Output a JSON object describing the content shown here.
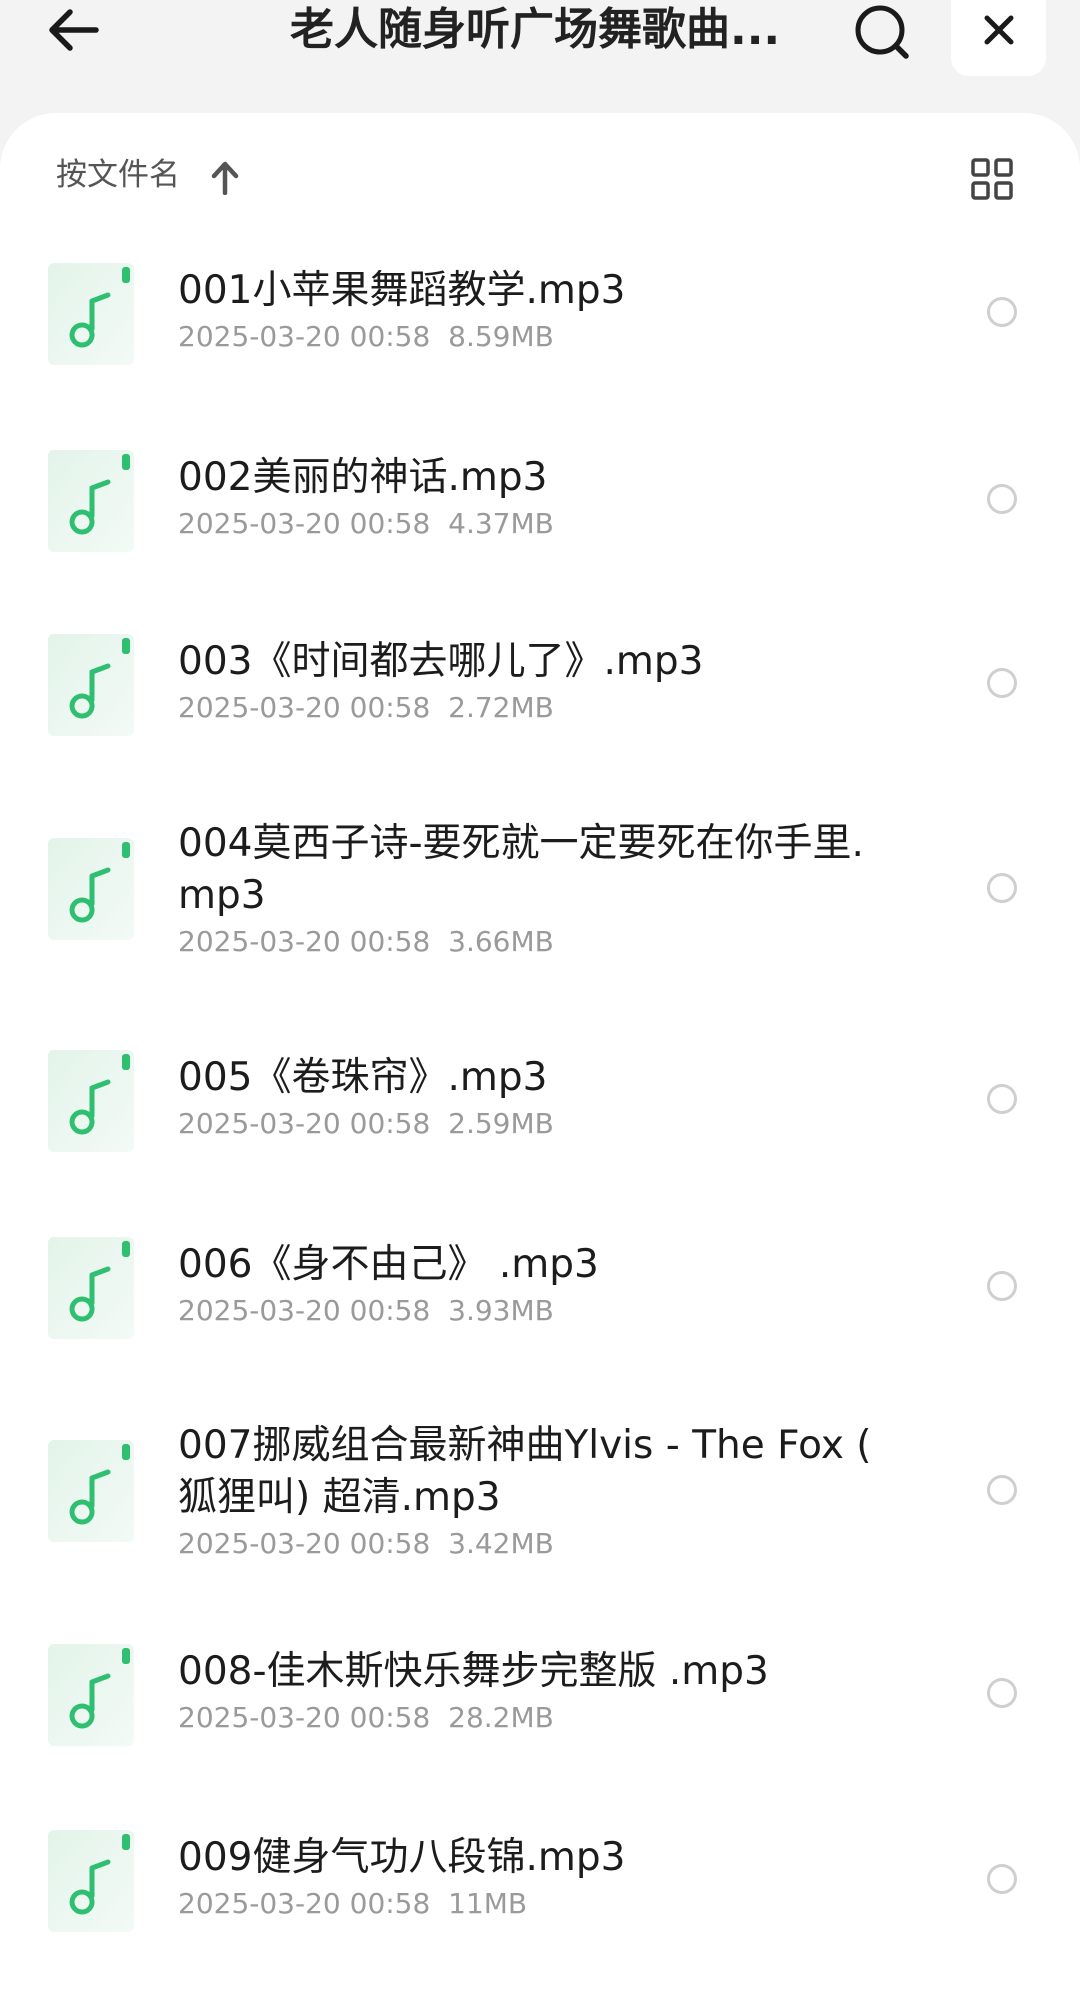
{
  "header": {
    "title": "老人随身听广场舞歌曲...",
    "back_icon": "arrow-left-icon",
    "search_icon": "search-icon",
    "close_icon": "close-icon"
  },
  "sortbar": {
    "label": "按文件名",
    "direction_icon": "arrow-up-icon",
    "view_icon": "grid-view-icon"
  },
  "colors": {
    "accent_green": "#2fbf71",
    "icon_bg": "#e8f6ee",
    "meta_gray": "#9a9a9a"
  },
  "files": [
    {
      "name": "001小苹果舞蹈教学.mp3",
      "date": "2025-03-20 00:58",
      "size": "8.59MB"
    },
    {
      "name": "002美丽的神话.mp3",
      "date": "2025-03-20 00:58",
      "size": "4.37MB"
    },
    {
      "name": "003《时间都去哪儿了》.mp3",
      "date": "2025-03-20 00:58",
      "size": "2.72MB"
    },
    {
      "name": "004莫西子诗-要死就一定要死在你手里.",
      "name_line2": "mp3",
      "date": "2025-03-20 00:58",
      "size": "3.66MB"
    },
    {
      "name": "005《卷珠帘》.mp3",
      "date": "2025-03-20 00:58",
      "size": "2.59MB"
    },
    {
      "name": "006《身不由己》 .mp3",
      "date": "2025-03-20 00:58",
      "size": "3.93MB"
    },
    {
      "name": "007挪威组合最新神曲Ylvis - The Fox (",
      "name_line2": "狐狸叫) 超清.mp3",
      "date": "2025-03-20 00:58",
      "size": "3.42MB"
    },
    {
      "name": "008-佳木斯快乐舞步完整版 .mp3",
      "date": "2025-03-20 00:58",
      "size": "28.2MB"
    },
    {
      "name": "009健身气功八段锦.mp3",
      "date": "2025-03-20 00:58",
      "size": "11MB"
    }
  ]
}
